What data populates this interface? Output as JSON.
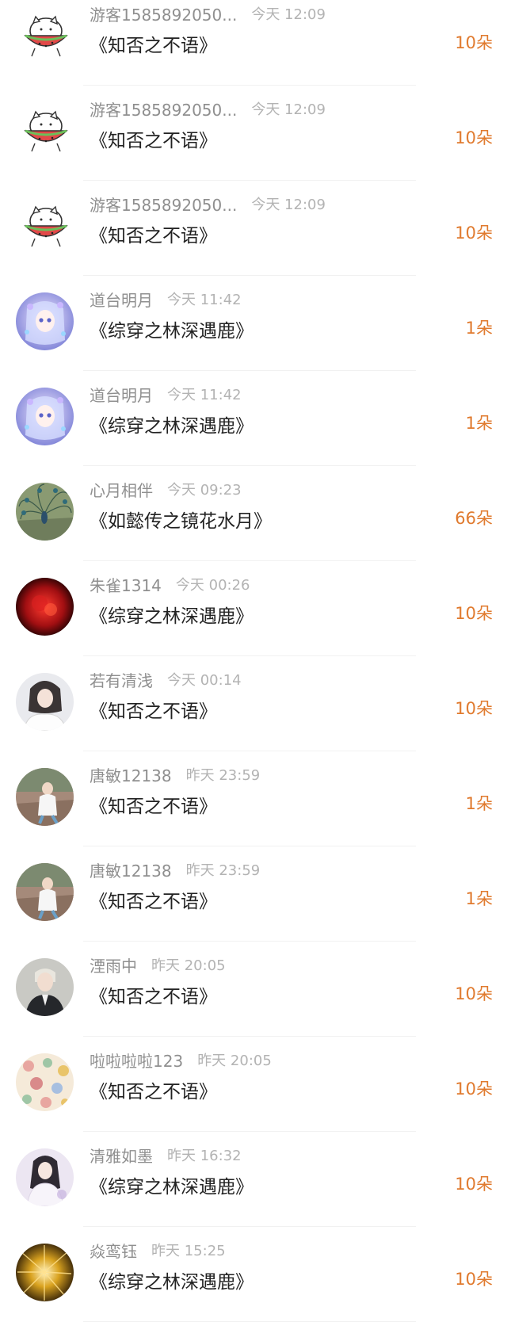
{
  "unit": "朵",
  "colors": {
    "accent": "#e07a2e",
    "username": "#8f8f8f",
    "time": "#b3b3b3",
    "title": "#222222",
    "divider": "#f1f1f1"
  },
  "rows": [
    {
      "username": "游客1585892050...",
      "time": "今天 12:09",
      "book": "《知否之不语》",
      "amount": "10朵",
      "avatar": "watermelon-cat-avatar"
    },
    {
      "username": "游客1585892050...",
      "time": "今天 12:09",
      "book": "《知否之不语》",
      "amount": "10朵",
      "avatar": "watermelon-cat-avatar"
    },
    {
      "username": "游客1585892050...",
      "time": "今天 12:09",
      "book": "《知否之不语》",
      "amount": "10朵",
      "avatar": "watermelon-cat-avatar"
    },
    {
      "username": "道台明月",
      "time": "今天 11:42",
      "book": "《综穿之林深遇鹿》",
      "amount": "1朵",
      "avatar": "anime-girl-avatar"
    },
    {
      "username": "道台明月",
      "time": "今天 11:42",
      "book": "《综穿之林深遇鹿》",
      "amount": "1朵",
      "avatar": "anime-girl-avatar"
    },
    {
      "username": "心月相伴",
      "time": "今天 09:23",
      "book": "《如懿传之镜花水月》",
      "amount": "66朵",
      "avatar": "peacock-avatar"
    },
    {
      "username": "朱雀1314",
      "time": "今天 00:26",
      "book": "《综穿之林深遇鹿》",
      "amount": "10朵",
      "avatar": "red-flower-avatar"
    },
    {
      "username": "若有清浅",
      "time": "今天 00:14",
      "book": "《知否之不语》",
      "amount": "10朵",
      "avatar": "portrait-white-avatar"
    },
    {
      "username": "唐敏12138",
      "time": "昨天 23:59",
      "book": "《知否之不语》",
      "amount": "1朵",
      "avatar": "woman-outdoor-avatar"
    },
    {
      "username": "唐敏12138",
      "time": "昨天 23:59",
      "book": "《知否之不语》",
      "amount": "1朵",
      "avatar": "woman-outdoor-avatar"
    },
    {
      "username": "湮雨中",
      "time": "昨天 20:05",
      "book": "《知否之不语》",
      "amount": "10朵",
      "avatar": "man-dark-avatar"
    },
    {
      "username": "啦啦啦啦123",
      "time": "昨天 20:05",
      "book": "《知否之不语》",
      "amount": "10朵",
      "avatar": "floral-pattern-avatar"
    },
    {
      "username": "清雅如墨",
      "time": "昨天 16:32",
      "book": "《综穿之林深遇鹿》",
      "amount": "10朵",
      "avatar": "girl-lavender-avatar"
    },
    {
      "username": "焱鸾钰",
      "time": "昨天 15:25",
      "book": "《综穿之林深遇鹿》",
      "amount": "10朵",
      "avatar": "gold-burst-avatar"
    }
  ]
}
